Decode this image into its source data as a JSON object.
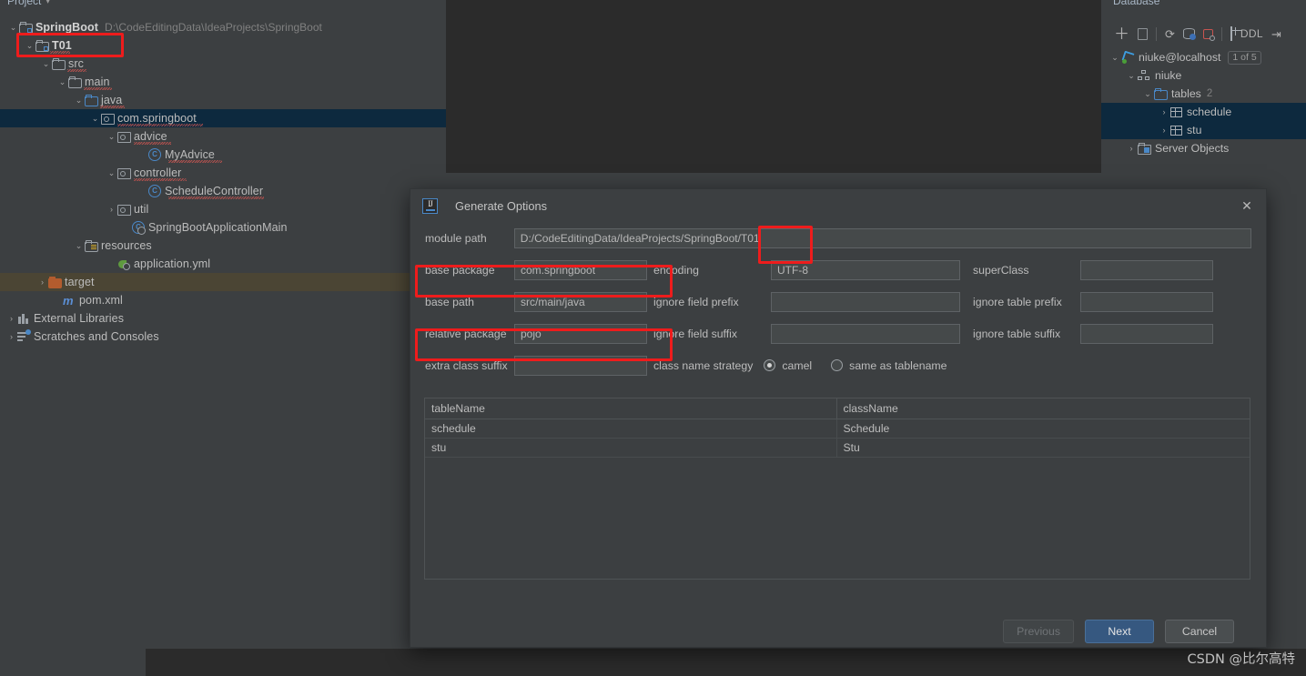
{
  "project_panel": {
    "header": "Project",
    "tree": [
      {
        "label": "SpringBoot",
        "sub": "D:\\CodeEditingData\\IdeaProjects\\SpringBoot",
        "icon": "module-folder-icon",
        "depth": 0,
        "twisty": "v",
        "bold": true
      },
      {
        "label": "T01",
        "sub": "",
        "icon": "module-folder-icon",
        "depth": 1,
        "twisty": "v",
        "bold": true
      },
      {
        "label": "src",
        "sub": "",
        "icon": "folder-icon",
        "depth": 2,
        "twisty": "v"
      },
      {
        "label": "main",
        "sub": "",
        "icon": "folder-icon",
        "depth": 3,
        "twisty": "v"
      },
      {
        "label": "java",
        "sub": "",
        "icon": "source-folder-icon",
        "depth": 4,
        "twisty": "v"
      },
      {
        "label": "com.springboot",
        "sub": "",
        "icon": "package-icon",
        "depth": 5,
        "twisty": "v",
        "selected": true
      },
      {
        "label": "advice",
        "sub": "",
        "icon": "package-icon",
        "depth": 6,
        "twisty": "v"
      },
      {
        "label": "MyAdvice",
        "sub": "",
        "icon": "java-class-icon",
        "depth": 7,
        "twisty": ""
      },
      {
        "label": "controller",
        "sub": "",
        "icon": "package-icon",
        "depth": 6,
        "twisty": "v"
      },
      {
        "label": "ScheduleController",
        "sub": "",
        "icon": "java-class-icon",
        "depth": 7,
        "twisty": ""
      },
      {
        "label": "util",
        "sub": "",
        "icon": "package-icon",
        "depth": 6,
        "twisty": ">"
      },
      {
        "label": "SpringBootApplicationMain",
        "sub": "",
        "icon": "java-main-class-icon",
        "depth": 6,
        "twisty": ""
      },
      {
        "label": "resources",
        "sub": "",
        "icon": "resources-folder-icon",
        "depth": 4,
        "twisty": "v"
      },
      {
        "label": "application.yml",
        "sub": "",
        "icon": "yaml-file-icon",
        "depth": 5,
        "twisty": ""
      },
      {
        "label": "target",
        "sub": "",
        "icon": "excluded-folder-icon",
        "depth": 3,
        "twisty": ">",
        "highlight": true
      },
      {
        "label": "pom.xml",
        "sub": "",
        "icon": "maven-file-icon",
        "depth": 3,
        "twisty": ""
      },
      {
        "label": "External Libraries",
        "sub": "",
        "icon": "libraries-icon",
        "depth": 0,
        "twisty": ">"
      },
      {
        "label": "Scratches and Consoles",
        "sub": "",
        "icon": "scratches-icon",
        "depth": 0,
        "twisty": ">"
      }
    ]
  },
  "database_panel": {
    "title": "Database",
    "toolbar": [
      "add-icon",
      "copy-icon",
      "refresh-icon",
      "db-properties-icon",
      "stop-icon",
      "table-icon",
      "DDL",
      "jump-to-console-icon"
    ],
    "tree": [
      {
        "label": "niuke@localhost",
        "badge": "1 of 5",
        "icon": "datasource-icon",
        "depth": 0,
        "twisty": "v"
      },
      {
        "label": "niuke",
        "badge": "",
        "icon": "schema-icon",
        "depth": 1,
        "twisty": "v"
      },
      {
        "label": "tables",
        "badge": "",
        "count": "2",
        "icon": "folder-icon",
        "depth": 2,
        "twisty": "v"
      },
      {
        "label": "schedule",
        "badge": "",
        "icon": "table-icon",
        "depth": 3,
        "twisty": ">",
        "selected": true
      },
      {
        "label": "stu",
        "badge": "",
        "icon": "table-icon",
        "depth": 3,
        "twisty": ">",
        "selected": true
      },
      {
        "label": "Server Objects",
        "badge": "",
        "icon": "server-objects-icon",
        "depth": 1,
        "twisty": ">"
      }
    ]
  },
  "dialog": {
    "title": "Generate Options",
    "close_label": "✕",
    "fields": {
      "module_path_label": "module path",
      "module_path_value": "D:/CodeEditingData/IdeaProjects/SpringBoot/T01",
      "base_package_label": "base package",
      "base_package_value": "com.springboot",
      "encoding_label": "encoding",
      "encoding_value": "UTF-8",
      "superclass_label": "superClass",
      "superclass_value": "",
      "base_path_label": "base path",
      "base_path_value": "src/main/java",
      "ignore_field_prefix_label": "ignore field prefix",
      "ignore_field_prefix_value": "",
      "ignore_table_prefix_label": "ignore table prefix",
      "ignore_table_prefix_value": "",
      "relative_package_label": "relative package",
      "relative_package_value": "pojo",
      "ignore_field_suffix_label": "ignore field suffix",
      "ignore_field_suffix_value": "",
      "ignore_table_suffix_label": "ignore table suffix",
      "ignore_table_suffix_value": "",
      "extra_class_suffix_label": "extra class suffix",
      "extra_class_suffix_value": "",
      "class_name_strategy_label": "class name strategy",
      "strategy_option_camel": "camel",
      "strategy_option_same": "same as tablename",
      "strategy_selected": "camel"
    },
    "table": {
      "columns": [
        "tableName",
        "className"
      ],
      "rows": [
        [
          "schedule",
          "Schedule"
        ],
        [
          "stu",
          "Stu"
        ]
      ]
    },
    "buttons": {
      "previous": "Previous",
      "next": "Next",
      "cancel": "Cancel"
    }
  },
  "annotations": {
    "highlight_color": "#ee1c1c",
    "boxes": [
      "tree-t01",
      "module-path-t01",
      "base-package",
      "relative-package"
    ]
  },
  "watermark": "CSDN @比尔高特"
}
